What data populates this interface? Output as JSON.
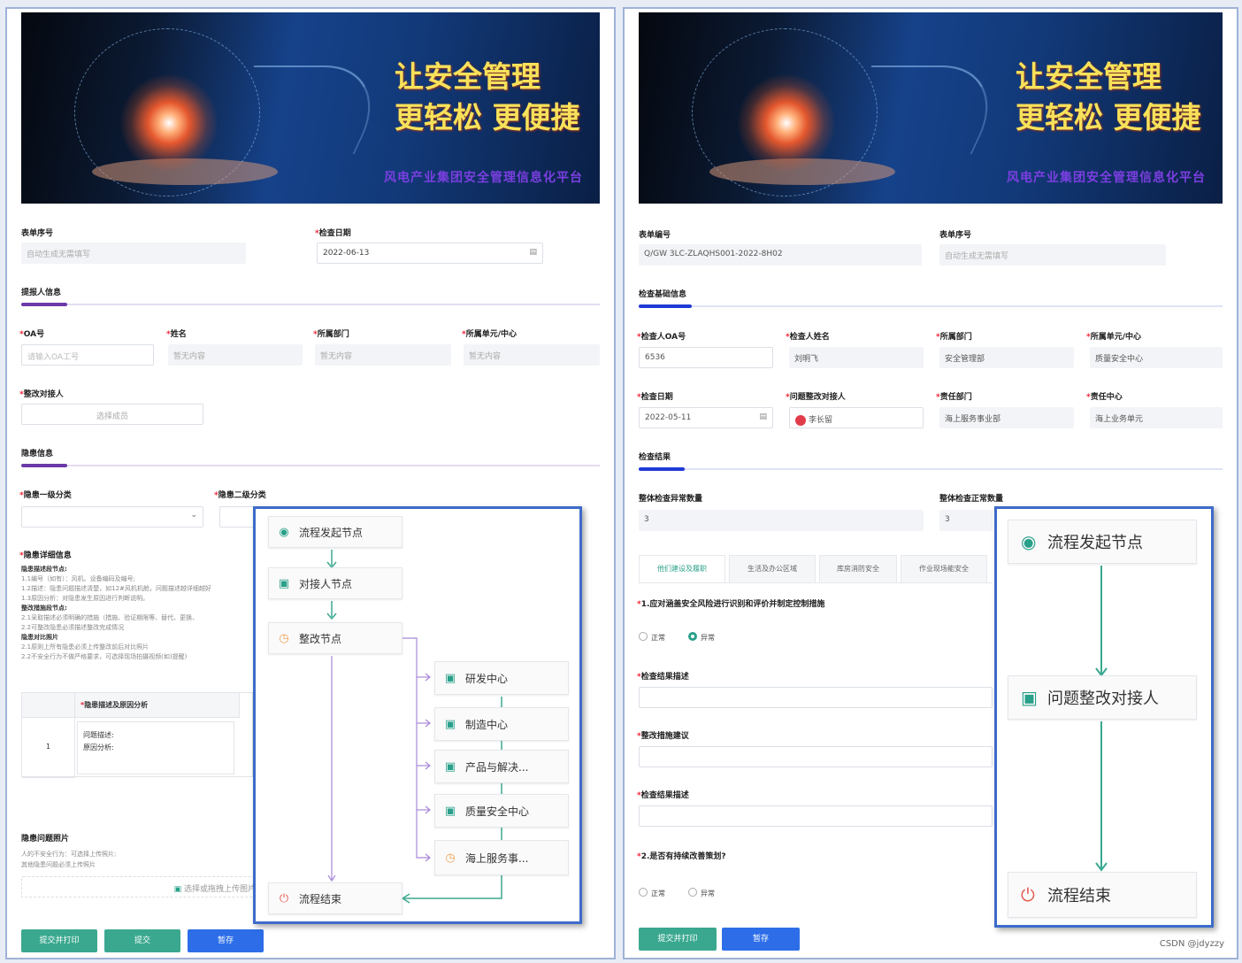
{
  "banner": {
    "title_line1": "让安全管理",
    "title_line2": "更轻松  更便捷",
    "platform_name": "风电产业集团安全管理信息化平台"
  },
  "left_form": {
    "form_no_label": "表单序号",
    "form_no_placeholder": "自动生成无需填写",
    "check_date_label": "检查日期",
    "check_date_value": "2022-06-13",
    "reporter_section": "提报人信息",
    "oa_label": "OA号",
    "oa_placeholder": "请输入OA工号",
    "name_label": "姓名",
    "name_placeholder": "暂无内容",
    "dept_label": "所属部门",
    "dept_placeholder": "暂无内容",
    "unit_label": "所属单元/中心",
    "unit_placeholder": "暂无内容",
    "rectify_person_label": "整改对接人",
    "rectify_person_placeholder": "选择成员",
    "hazard_section": "隐患信息",
    "cat1_label": "隐患一级分类",
    "cat2_label": "隐患二级分类",
    "detail_label": "隐患详细信息",
    "help_lines": [
      {
        "bold": true,
        "text": "隐患描述段节点:"
      },
      {
        "bold": false,
        "text": "1.1编号（如有）：风机、设备编码及编号;"
      },
      {
        "bold": false,
        "text": "1.2描述：隐患问题描述清楚，如12#风机机舱，问题描述越详细越好"
      },
      {
        "bold": false,
        "text": "1.3原因分析：对隐患发生原因进行判断说明。"
      },
      {
        "bold": true,
        "text": "整改措施段节点:"
      },
      {
        "bold": false,
        "text": "2.1采取描述必须明确的措施（措施、验证期限等、替代、更换、"
      },
      {
        "bold": false,
        "text": "2.2可整改隐患必须描述整改完成情况"
      },
      {
        "bold": true,
        "text": "隐患对比照片"
      },
      {
        "bold": false,
        "text": "2.1原则上所有隐患必须上传整改前后对比照片"
      },
      {
        "bold": false,
        "text": "2.2不安全行为不做严格要求，可选择现场拍摄视频(如)提醒)"
      }
    ],
    "table_header_col2": "隐患描述及原因分析",
    "table_row_no": "1",
    "table_row_line1": "问题描述:",
    "table_row_line2": "原因分析:",
    "photo_label": "隐患问题照片",
    "photo_help1": "人的不安全行为：可选择上传照片;",
    "photo_help2": "其他隐患问题必须上传照片",
    "upload_label": "选择或拖拽上传图片",
    "btn_submit_print": "提交并打印",
    "btn_submit": "提交",
    "btn_save": "暂存"
  },
  "left_flow": {
    "start": "流程发起节点",
    "contact": "对接人节点",
    "rectify": "整改节点",
    "branches": [
      "研发中心",
      "制造中心",
      "产品与解决...",
      "质量安全中心",
      "海上服务事..."
    ],
    "end": "流程结束"
  },
  "right_form": {
    "form_no_label": "表单编号",
    "form_no_value": "Q/GW 3LC-ZLAQHS001-2022-8H02",
    "form_seq_label": "表单序号",
    "form_seq_placeholder": "自动生成无需填写",
    "basic_section": "检查基础信息",
    "inspector_oa_label": "检查人OA号",
    "inspector_oa_value": "6536",
    "inspector_name_label": "检查人姓名",
    "inspector_name_value": "刘明飞",
    "dept_label": "所属部门",
    "dept_value": "安全管理部",
    "unit_label": "所属单元/中心",
    "unit_value": "质量安全中心",
    "check_date_label": "检查日期",
    "check_date_value": "2022-05-11",
    "issue_person_label": "问题整改对接人",
    "issue_person_value": "李长留",
    "resp_dept_label": "责任部门",
    "resp_dept_value": "海上服务事业部",
    "resp_center_label": "责任中心",
    "resp_center_value": "海上业务单元",
    "result_section": "检查结果",
    "abnormal_count_label": "整体检查异常数量",
    "abnormal_count_value": "3",
    "normal_count_label": "整体检查正常数量",
    "normal_count_value": "3",
    "tabs": [
      "他们建设及履职",
      "生活及办公区域",
      "库房消防安全",
      "作业现场能安全"
    ],
    "q1": "1.应对涵盖安全风险进行识别和评价并制定控制措施",
    "q1_normal": "正常",
    "q1_abnormal": "异常",
    "result_desc_label": "检查结果描述",
    "rectify_suggest_label": "整改措施建议",
    "result_desc2_label": "检查结果描述",
    "q2": "2.是否有持续改善策划?",
    "q2_normal": "正常",
    "q2_abnormal": "异常",
    "btn_submit_print": "提交并打印",
    "btn_save": "暂存"
  },
  "right_flow": {
    "start": "流程发起节点",
    "contact": "问题整改对接人",
    "end": "流程结束"
  },
  "watermark": "CSDN @jdyzzy",
  "colors": {
    "accent_teal": "#29a08a",
    "button_teal": "#3aa88f",
    "button_blue": "#2d6ee8",
    "flow_border": "#3d6bc9",
    "section_purple": "#6b3aa8",
    "section_blue": "#1f3ad6"
  }
}
